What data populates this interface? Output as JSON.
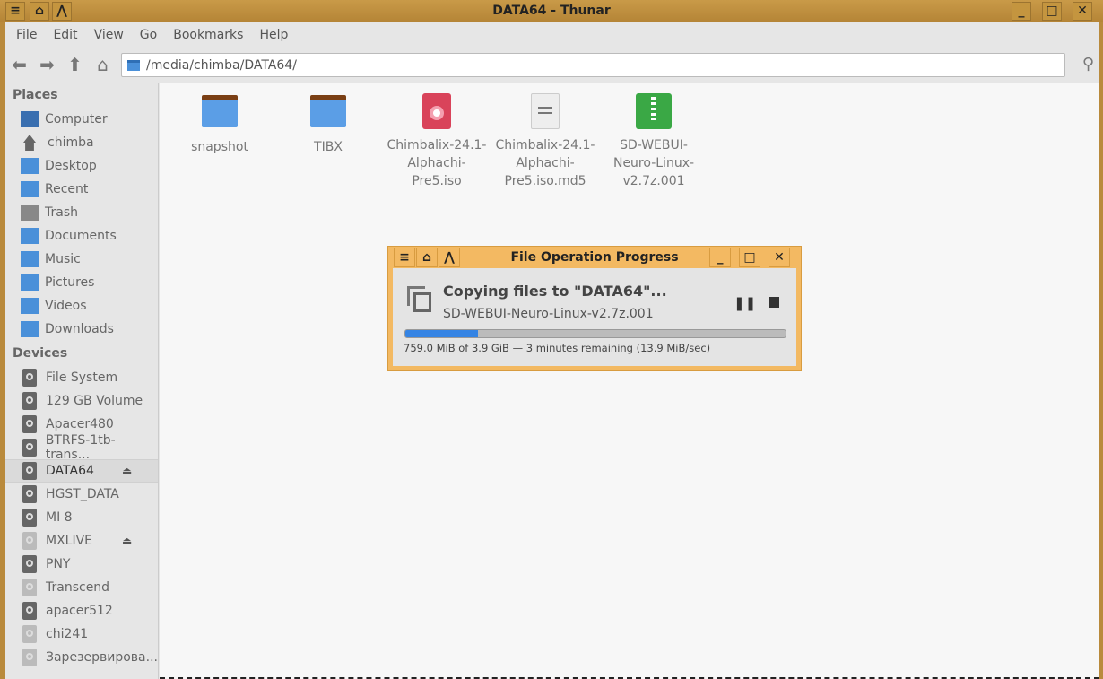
{
  "window": {
    "title": "DATA64 - Thunar"
  },
  "menu": [
    "File",
    "Edit",
    "View",
    "Go",
    "Bookmarks",
    "Help"
  ],
  "address": "/media/chimba/DATA64/",
  "sidebar": {
    "places_header": "Places",
    "places": [
      "Computer",
      "chimba",
      "Desktop",
      "Recent",
      "Trash",
      "Documents",
      "Music",
      "Pictures",
      "Videos",
      "Downloads"
    ],
    "devices_header": "Devices",
    "devices": [
      "File System",
      "129 GB Volume",
      "Apacer480",
      "BTRFS-1tb-trans...",
      "DATA64",
      "HGST_DATA",
      "MI 8",
      "MXLIVE",
      "PNY",
      "Transcend",
      "apacer512",
      "chi241",
      "Зарезервирова..."
    ]
  },
  "files": [
    {
      "l1": "snapshot",
      "l2": "",
      "l3": "",
      "type": "folder"
    },
    {
      "l1": "TIBX",
      "l2": "",
      "l3": "",
      "type": "folder"
    },
    {
      "l1": "Chimbalix-24.1-",
      "l2": "Alphachi-",
      "l3": "Pre5.iso",
      "type": "iso"
    },
    {
      "l1": "Chimbalix-24.1-",
      "l2": "Alphachi-",
      "l3": "Pre5.iso.md5",
      "type": "text"
    },
    {
      "l1": "SD-WEBUI-",
      "l2": "Neuro-Linux-",
      "l3": "v2.7z.001",
      "type": "archive"
    }
  ],
  "dialog": {
    "title": "File Operation Progress",
    "heading": "Copying files to \"DATA64\"...",
    "file": "SD-WEBUI-Neuro-Linux-v2.7z.001",
    "status": "759.0 MiB of 3.9 GiB — 3 minutes remaining (13.9 MiB/sec)",
    "progress_fraction": 0.19
  }
}
